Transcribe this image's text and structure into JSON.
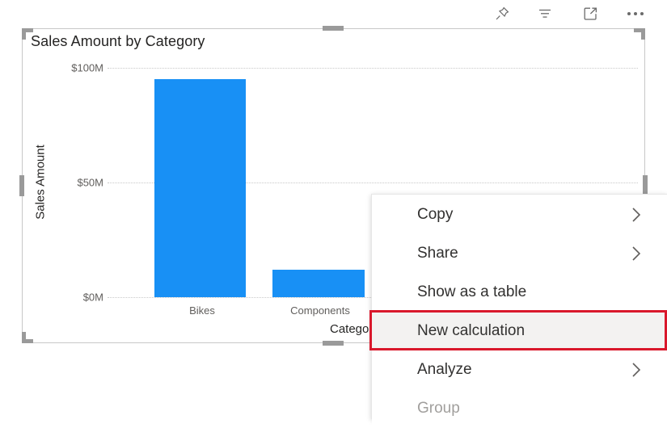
{
  "toolbar": {
    "icons": [
      {
        "name": "pin-icon",
        "label": "Pin to a dashboard"
      },
      {
        "name": "filter-icon",
        "label": "Filters"
      },
      {
        "name": "focus-icon",
        "label": "Focus mode"
      },
      {
        "name": "more-options-icon",
        "label": "More options"
      }
    ]
  },
  "visual": {
    "title": "Sales Amount by Category",
    "selected": true
  },
  "chart_data": {
    "type": "bar",
    "title": "Sales Amount by Category",
    "xlabel": "Category",
    "ylabel": "Sales Amount",
    "categories": [
      "Bikes",
      "Components"
    ],
    "values": [
      95,
      12
    ],
    "value_unit": "$M",
    "ylim": [
      0,
      100
    ],
    "ytick_labels": [
      "$0M",
      "$50M",
      "$100M"
    ],
    "ytick_values": [
      0,
      50,
      100
    ],
    "grid": true,
    "legend": "none",
    "series_color": "#1890f5"
  },
  "context_menu": {
    "items": [
      {
        "label": "Copy",
        "has_submenu": true,
        "disabled": false,
        "highlighted": false
      },
      {
        "label": "Share",
        "has_submenu": true,
        "disabled": false,
        "highlighted": false
      },
      {
        "label": "Show as a table",
        "has_submenu": false,
        "disabled": false,
        "highlighted": false
      },
      {
        "label": "New calculation",
        "has_submenu": false,
        "disabled": false,
        "highlighted": true
      },
      {
        "label": "Analyze",
        "has_submenu": true,
        "disabled": false,
        "highlighted": false
      },
      {
        "label": "Group",
        "has_submenu": false,
        "disabled": true,
        "highlighted": false
      }
    ],
    "highlight_color": "#d9182c"
  }
}
